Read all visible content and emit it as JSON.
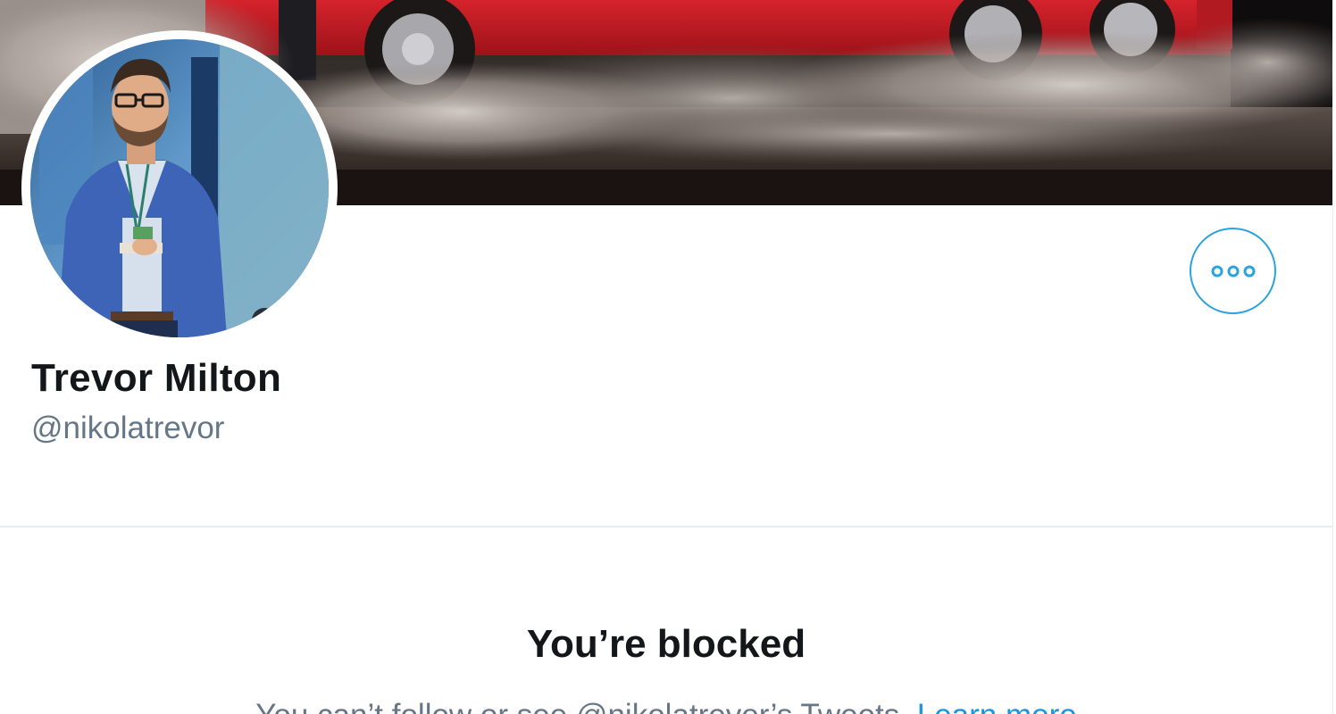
{
  "profile": {
    "display_name": "Trevor Milton",
    "handle": "@nikolatrevor"
  },
  "header": {
    "banner": "banner-photo",
    "avatar": "avatar-photo"
  },
  "actions": {
    "more_icon": "more-horizontal-icon"
  },
  "blocked": {
    "title": "You’re blocked",
    "message": "You can’t follow or see @nikolatrevor’s Tweets.",
    "learn_more": "Learn more"
  },
  "colors": {
    "accent": "#1da1f2",
    "link": "#1b95e0",
    "primary_text": "#14171a",
    "secondary_text": "#657786",
    "border": "#e6ecf0"
  }
}
